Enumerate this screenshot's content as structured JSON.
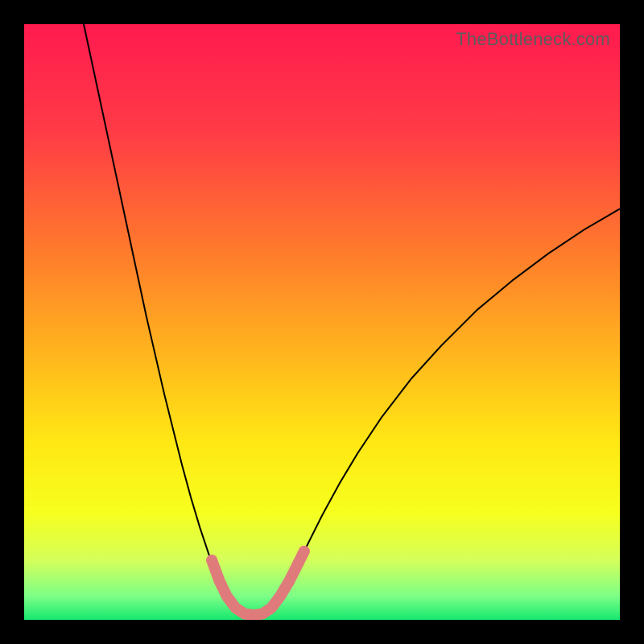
{
  "watermark": "TheBottleneck.com",
  "chart_data": {
    "type": "line",
    "title": "",
    "xlabel": "",
    "ylabel": "",
    "xlim": [
      0,
      100
    ],
    "ylim": [
      0,
      100
    ],
    "gradient_stops": [
      {
        "offset": 0.0,
        "color": "#ff1a4f"
      },
      {
        "offset": 0.18,
        "color": "#ff3b46"
      },
      {
        "offset": 0.38,
        "color": "#ff7a2c"
      },
      {
        "offset": 0.55,
        "color": "#ffb41e"
      },
      {
        "offset": 0.7,
        "color": "#ffe714"
      },
      {
        "offset": 0.82,
        "color": "#f7ff1e"
      },
      {
        "offset": 0.9,
        "color": "#d4ff5a"
      },
      {
        "offset": 0.96,
        "color": "#7dff87"
      },
      {
        "offset": 1.0,
        "color": "#17e86f"
      }
    ],
    "series": [
      {
        "name": "bottleneck-curve",
        "stroke": "#000000",
        "stroke_width": 2,
        "points": [
          {
            "x": 10.0,
            "y": 100.0
          },
          {
            "x": 11.5,
            "y": 93.0
          },
          {
            "x": 13.0,
            "y": 86.0
          },
          {
            "x": 14.5,
            "y": 79.0
          },
          {
            "x": 16.0,
            "y": 72.0
          },
          {
            "x": 17.5,
            "y": 65.0
          },
          {
            "x": 19.0,
            "y": 58.0
          },
          {
            "x": 20.5,
            "y": 51.0
          },
          {
            "x": 22.0,
            "y": 44.5
          },
          {
            "x": 23.5,
            "y": 38.0
          },
          {
            "x": 25.0,
            "y": 32.0
          },
          {
            "x": 26.5,
            "y": 26.0
          },
          {
            "x": 28.0,
            "y": 20.5
          },
          {
            "x": 29.5,
            "y": 15.5
          },
          {
            "x": 31.0,
            "y": 11.0
          },
          {
            "x": 32.5,
            "y": 7.0
          },
          {
            "x": 34.0,
            "y": 4.0
          },
          {
            "x": 35.5,
            "y": 2.0
          },
          {
            "x": 37.0,
            "y": 1.0
          },
          {
            "x": 38.5,
            "y": 0.8
          },
          {
            "x": 40.0,
            "y": 1.0
          },
          {
            "x": 41.5,
            "y": 2.0
          },
          {
            "x": 43.0,
            "y": 4.0
          },
          {
            "x": 44.5,
            "y": 6.5
          },
          {
            "x": 46.0,
            "y": 9.5
          },
          {
            "x": 48.0,
            "y": 13.5
          },
          {
            "x": 50.0,
            "y": 17.5
          },
          {
            "x": 53.0,
            "y": 23.0
          },
          {
            "x": 56.0,
            "y": 28.0
          },
          {
            "x": 60.0,
            "y": 34.0
          },
          {
            "x": 65.0,
            "y": 40.5
          },
          {
            "x": 70.0,
            "y": 46.0
          },
          {
            "x": 76.0,
            "y": 52.0
          },
          {
            "x": 82.0,
            "y": 57.0
          },
          {
            "x": 88.0,
            "y": 61.5
          },
          {
            "x": 94.0,
            "y": 65.5
          },
          {
            "x": 100.0,
            "y": 69.0
          }
        ]
      },
      {
        "name": "highlight-segment",
        "stroke": "#e07b7b",
        "stroke_width": 14,
        "linecap": "round",
        "points": [
          {
            "x": 31.5,
            "y": 10.0
          },
          {
            "x": 32.8,
            "y": 6.5
          },
          {
            "x": 34.0,
            "y": 4.0
          },
          {
            "x": 35.5,
            "y": 2.0
          },
          {
            "x": 37.0,
            "y": 1.0
          },
          {
            "x": 38.5,
            "y": 0.8
          },
          {
            "x": 40.0,
            "y": 1.0
          },
          {
            "x": 41.5,
            "y": 2.0
          },
          {
            "x": 43.0,
            "y": 4.0
          },
          {
            "x": 44.5,
            "y": 6.5
          },
          {
            "x": 46.0,
            "y": 9.5
          },
          {
            "x": 47.0,
            "y": 11.5
          }
        ]
      }
    ],
    "markers": [
      {
        "x": 31.5,
        "y": 10.0,
        "r": 7,
        "fill": "#e07b7b"
      },
      {
        "x": 32.8,
        "y": 6.5,
        "r": 7,
        "fill": "#e07b7b"
      },
      {
        "x": 44.5,
        "y": 6.5,
        "r": 7,
        "fill": "#e07b7b"
      },
      {
        "x": 46.0,
        "y": 9.5,
        "r": 7,
        "fill": "#e07b7b"
      },
      {
        "x": 47.0,
        "y": 11.5,
        "r": 7,
        "fill": "#e07b7b"
      }
    ]
  }
}
